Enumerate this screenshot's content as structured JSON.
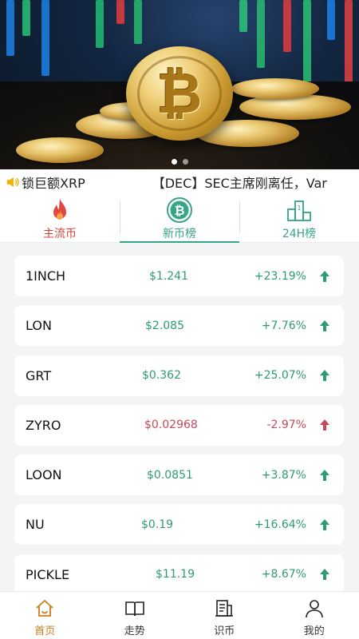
{
  "ticker": {
    "item1": "锁巨额XRP",
    "item2": "【DEC】SEC主席刚离任，Var"
  },
  "tabs": [
    {
      "label": "主流币",
      "icon": "fire-icon"
    },
    {
      "label": "新币榜",
      "icon": "bitcoin-icon",
      "active": true
    },
    {
      "label": "24H榜",
      "icon": "podium-icon"
    }
  ],
  "coins": [
    {
      "symbol": "1INCH",
      "price": "$1.241",
      "change": "+23.19%",
      "trend": "up"
    },
    {
      "symbol": "LON",
      "price": "$2.085",
      "change": "+7.76%",
      "trend": "up"
    },
    {
      "symbol": "GRT",
      "price": "$0.362",
      "change": "+25.07%",
      "trend": "up"
    },
    {
      "symbol": "ZYRO",
      "price": "$0.02968",
      "change": "-2.97%",
      "trend": "down"
    },
    {
      "symbol": "LOON",
      "price": "$0.0851",
      "change": "+3.87%",
      "trend": "up"
    },
    {
      "symbol": "NU",
      "price": "$0.19",
      "change": "+16.64%",
      "trend": "up"
    },
    {
      "symbol": "PICKLE",
      "price": "$11.19",
      "change": "+8.67%",
      "trend": "up"
    }
  ],
  "nav": [
    {
      "label": "首页",
      "icon": "home-icon",
      "active": true
    },
    {
      "label": "走势",
      "icon": "book-icon"
    },
    {
      "label": "识币",
      "icon": "news-icon"
    },
    {
      "label": "我的",
      "icon": "user-icon"
    }
  ],
  "colors": {
    "up": "#2f9a77",
    "down": "#c9485b",
    "accent": "#35a487",
    "hot": "#d0433a",
    "nav_active": "#d07c1d"
  }
}
